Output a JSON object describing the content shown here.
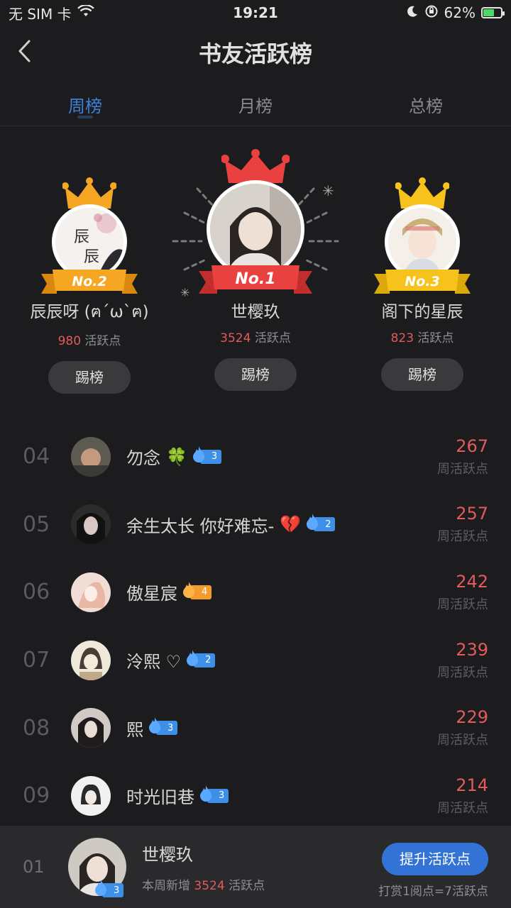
{
  "status": {
    "carrier": "无 SIM 卡",
    "time": "19:21",
    "battery": "62%"
  },
  "nav": {
    "title": "书友活跃榜"
  },
  "tabs": [
    {
      "label": "周榜",
      "active": true
    },
    {
      "label": "月榜",
      "active": false
    },
    {
      "label": "总榜",
      "active": false
    }
  ],
  "podium": {
    "first": {
      "badge": "No.1",
      "name": "世樱玖",
      "score": "3524",
      "unit": "活跃点",
      "button": "踢榜"
    },
    "second": {
      "badge": "No.2",
      "name": "辰辰呀 (ฅ´ω`ฅ)",
      "score": "980",
      "unit": "活跃点",
      "button": "踢榜",
      "avatar_text": "辰辰"
    },
    "third": {
      "badge": "No.3",
      "name": "阁下的星辰",
      "score": "823",
      "unit": "活跃点",
      "button": "踢榜"
    }
  },
  "list": [
    {
      "rank": "04",
      "name": "勿念",
      "emoji": "🍀",
      "level": "3",
      "badge_color": "blue",
      "score": "267",
      "label": "周活跃点"
    },
    {
      "rank": "05",
      "name": "余生太长 你好难忘-",
      "emoji": "💔",
      "level": "2",
      "badge_color": "blue",
      "score": "257",
      "label": "周活跃点"
    },
    {
      "rank": "06",
      "name": "傲星宸",
      "emoji": "",
      "level": "4",
      "badge_color": "orange",
      "score": "242",
      "label": "周活跃点"
    },
    {
      "rank": "07",
      "name": "泠熙 ♡",
      "emoji": "",
      "level": "2",
      "badge_color": "blue",
      "score": "239",
      "label": "周活跃点"
    },
    {
      "rank": "08",
      "name": "熙",
      "emoji": "",
      "level": "3",
      "badge_color": "blue",
      "score": "229",
      "label": "周活跃点"
    },
    {
      "rank": "09",
      "name": "时光旧巷",
      "emoji": "",
      "level": "3",
      "badge_color": "blue",
      "score": "214",
      "label": "周活跃点"
    }
  ],
  "me": {
    "rank": "01",
    "name": "世樱玖",
    "level": "3",
    "sub_prefix": "本周新增",
    "score": "3524",
    "sub_suffix": "活跃点",
    "button": "提升活跃点",
    "hint": "打赏1阅点=7活跃点"
  },
  "colors": {
    "background": "#1c1c1e",
    "accent_blue": "#3b82d6",
    "score_red": "#e25b5b",
    "gold": "#f5a623",
    "first_red": "#e9413f"
  }
}
